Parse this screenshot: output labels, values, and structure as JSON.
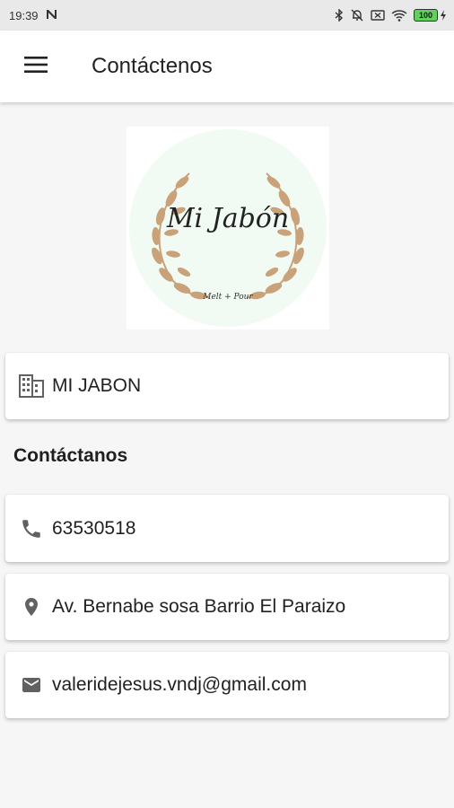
{
  "status_bar": {
    "time": "19:39",
    "battery_level": "100"
  },
  "app_bar": {
    "title": "Contáctenos",
    "menu_icon": "hamburger-menu-icon"
  },
  "logo": {
    "brand_name": "Mi Jabón",
    "tagline": "Melt + Pour"
  },
  "company": {
    "icon": "building-icon",
    "name": "MI JABON"
  },
  "contact_section": {
    "heading": "Contáctanos",
    "items": [
      {
        "icon": "phone-icon",
        "text": "63530518"
      },
      {
        "icon": "location-pin-icon",
        "text": "Av. Bernabe sosa Barrio El Paraizo"
      },
      {
        "icon": "email-icon",
        "text": "valeridejesus.vndj@gmail.com"
      }
    ]
  },
  "colors": {
    "app_bar_bg": "#ffffff",
    "page_bg": "#f6f6f6",
    "icon_gray": "#616161",
    "logo_circle": "#f1fbf3",
    "laurel": "#c9a27a"
  }
}
